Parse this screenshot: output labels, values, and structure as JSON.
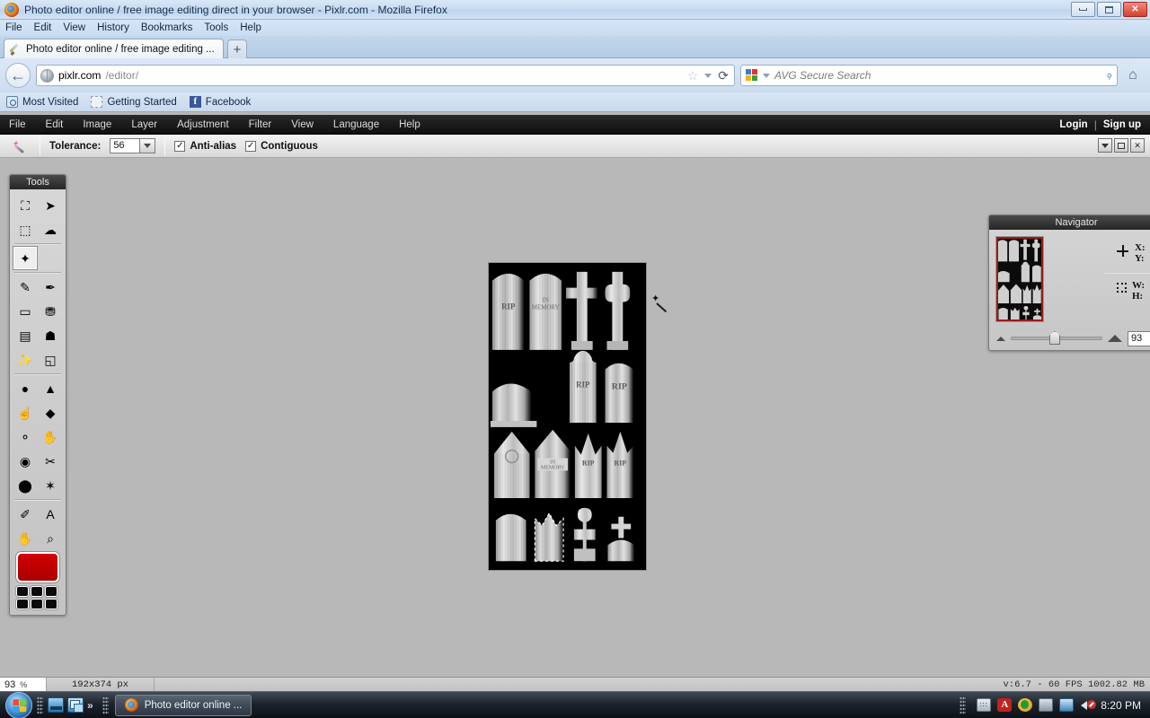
{
  "browser": {
    "window_title": "Photo editor online / free image editing direct in your browser - Pixlr.com - Mozilla Firefox",
    "menus": [
      "File",
      "Edit",
      "View",
      "History",
      "Bookmarks",
      "Tools",
      "Help"
    ],
    "tab_title": "Photo editor online / free image editing ...",
    "new_tab_label": "+",
    "back_label": "←",
    "url_host": "pixlr.com",
    "url_path": "/editor/",
    "star_label": "☆",
    "reload_label": "⟳",
    "search_placeholder": "AVG Secure Search",
    "search_icon_label": "⌕",
    "home_icon_label": "⌂",
    "bookmarks": [
      "Most Visited",
      "Getting Started",
      "Facebook"
    ],
    "window_controls": {
      "minimize": "minimize-icon",
      "maximize": "maximize-icon",
      "close": "✕"
    }
  },
  "pixlr": {
    "menus": [
      "File",
      "Edit",
      "Image",
      "Layer",
      "Adjustment",
      "Filter",
      "View",
      "Language",
      "Help"
    ],
    "account": {
      "login": "Login",
      "separator": "|",
      "signup": "Sign up"
    },
    "options_bar": {
      "active_tool_icon": "magic-wand-icon",
      "tolerance_label": "Tolerance:",
      "tolerance_value": "56",
      "antialias_label": "Anti-alias",
      "antialias_checked": "✓",
      "contiguous_label": "Contiguous",
      "contiguous_checked": "✓",
      "window_buttons": [
        "collapse",
        "restore",
        "close"
      ],
      "close_label": "✕"
    },
    "tools_panel": {
      "title": "Tools",
      "items": [
        {
          "name": "crop-tool",
          "icon": "⛶",
          "selected": false
        },
        {
          "name": "move-tool",
          "icon": "➤",
          "selected": false
        },
        {
          "name": "marquee-select-tool",
          "icon": "⬚",
          "selected": false
        },
        {
          "name": "lasso-tool",
          "icon": "☁",
          "selected": false
        },
        {
          "name": "magic-wand-tool",
          "icon": "✦",
          "selected": true
        },
        {
          "name": "pencil-tool",
          "icon": "✎",
          "selected": false
        },
        {
          "name": "brush-tool",
          "icon": "✒",
          "selected": false
        },
        {
          "name": "eraser-tool",
          "icon": "▭",
          "selected": false
        },
        {
          "name": "paint-bucket-tool",
          "icon": "⛃",
          "selected": false
        },
        {
          "name": "gradient-tool",
          "icon": "▤",
          "selected": false
        },
        {
          "name": "clone-stamp-tool",
          "icon": "☗",
          "selected": false
        },
        {
          "name": "color-replace-tool",
          "icon": "✨",
          "selected": false
        },
        {
          "name": "drawing-tool",
          "icon": "◱",
          "selected": false
        },
        {
          "name": "blur-tool",
          "icon": "●",
          "selected": false
        },
        {
          "name": "sharpen-tool",
          "icon": "▲",
          "selected": false
        },
        {
          "name": "smudge-tool",
          "icon": "☝",
          "selected": false
        },
        {
          "name": "sponge-tool",
          "icon": "◆",
          "selected": false
        },
        {
          "name": "dodge-tool",
          "icon": "⚬",
          "selected": false
        },
        {
          "name": "burn-tool",
          "icon": "✋",
          "selected": false
        },
        {
          "name": "red-eye-tool",
          "icon": "◉",
          "selected": false
        },
        {
          "name": "spot-heal-tool",
          "icon": "✂",
          "selected": false
        },
        {
          "name": "bloat-tool",
          "icon": "⬤",
          "selected": false
        },
        {
          "name": "pinch-tool",
          "icon": "✶",
          "selected": false
        },
        {
          "name": "color-picker-tool",
          "icon": "✐",
          "selected": false
        },
        {
          "name": "type-tool",
          "icon": "A",
          "selected": false
        },
        {
          "name": "hand-tool",
          "icon": "✋",
          "selected": false
        },
        {
          "name": "zoom-tool",
          "icon": "⌕",
          "selected": false
        }
      ],
      "primary_color": "#d40000",
      "palette_swatch_color": "#0a0a0a",
      "palette_swatch_count": 6
    },
    "navigator": {
      "title": "Navigator",
      "x_label": "X:",
      "y_label": "Y:",
      "w_label": "W:",
      "h_label": "H:",
      "zoom_value": "93",
      "zoom_out_icon": "small-triangle-icon",
      "zoom_in_icon": "large-triangle-icon",
      "viewbox_color": "#9b1b1b"
    },
    "canvas": {
      "image_description": "grayscale tombstone / gravestone sprite sheet on black background",
      "selection_active": true,
      "cursor_icon": "magic-wand-cursor"
    },
    "status_bar": {
      "zoom_value": "93",
      "zoom_unit": "%",
      "dimensions": "192x374 px",
      "version_info": "v:6.7 - 60 FPS 1002.82 MB"
    }
  },
  "taskbar": {
    "start_label": "start-orb",
    "quick_launch": [
      "show-desktop-icon",
      "switch-windows-icon"
    ],
    "overflow_label": "»",
    "tasks": [
      {
        "label": "Photo editor online ...",
        "icon": "firefox-icon"
      }
    ],
    "tray_icons": [
      "keyboard-icon",
      "adobe-reader-icon",
      "avg-icon",
      "power-plug-icon",
      "network-icon",
      "volume-muted-icon"
    ],
    "clock": "8:20 PM"
  }
}
